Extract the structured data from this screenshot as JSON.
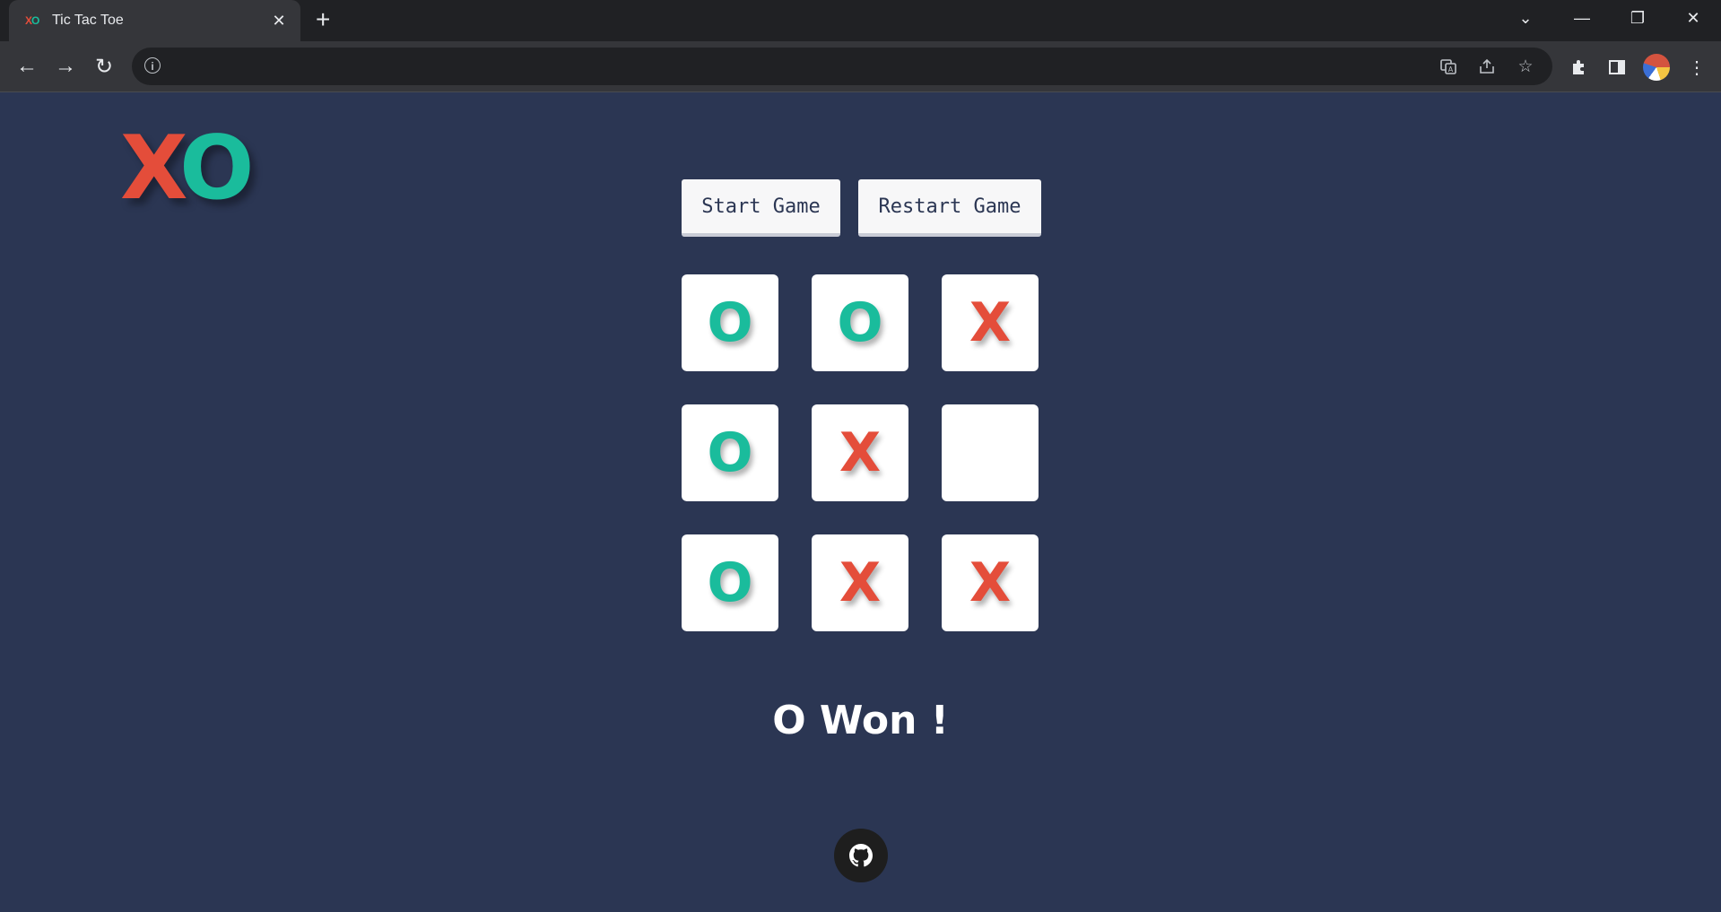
{
  "browser": {
    "tab": {
      "title": "Tic Tac Toe",
      "favicon": {
        "x": "X",
        "o": "O"
      },
      "close": "✕"
    },
    "new_tab": "+",
    "window_controls": {
      "tab_search": "⌄",
      "minimize": "—",
      "restore": "❐",
      "close": "✕"
    },
    "nav": {
      "back": "←",
      "forward": "→",
      "reload": "↻"
    },
    "omnibox": {
      "value": "",
      "info": "i"
    },
    "icons": {
      "translate": "translate-icon",
      "share": "share-icon",
      "bookmark": "☆",
      "extensions": "puzzle-icon",
      "side_panel": "side-panel-icon",
      "menu": "⋮"
    }
  },
  "logo": {
    "x": "X",
    "o": "O"
  },
  "buttons": {
    "start": "Start Game",
    "restart": "Restart Game"
  },
  "board": {
    "cells": [
      "O",
      "O",
      "X",
      "O",
      "X",
      "",
      "O",
      "X",
      "X"
    ]
  },
  "result": "O Won !",
  "colors": {
    "x": "#e44d3a",
    "o": "#1abc9c",
    "background": "#2b3653",
    "cell": "#ffffff"
  }
}
